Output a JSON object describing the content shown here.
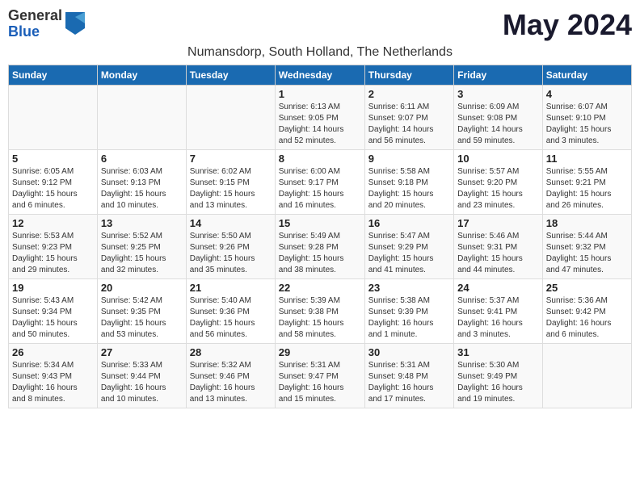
{
  "logo": {
    "general": "General",
    "blue": "Blue"
  },
  "title": "May 2024",
  "subtitle": "Numansdorp, South Holland, The Netherlands",
  "headers": [
    "Sunday",
    "Monday",
    "Tuesday",
    "Wednesday",
    "Thursday",
    "Friday",
    "Saturday"
  ],
  "weeks": [
    [
      {
        "day": "",
        "info": ""
      },
      {
        "day": "",
        "info": ""
      },
      {
        "day": "",
        "info": ""
      },
      {
        "day": "1",
        "info": "Sunrise: 6:13 AM\nSunset: 9:05 PM\nDaylight: 14 hours\nand 52 minutes."
      },
      {
        "day": "2",
        "info": "Sunrise: 6:11 AM\nSunset: 9:07 PM\nDaylight: 14 hours\nand 56 minutes."
      },
      {
        "day": "3",
        "info": "Sunrise: 6:09 AM\nSunset: 9:08 PM\nDaylight: 14 hours\nand 59 minutes."
      },
      {
        "day": "4",
        "info": "Sunrise: 6:07 AM\nSunset: 9:10 PM\nDaylight: 15 hours\nand 3 minutes."
      }
    ],
    [
      {
        "day": "5",
        "info": "Sunrise: 6:05 AM\nSunset: 9:12 PM\nDaylight: 15 hours\nand 6 minutes."
      },
      {
        "day": "6",
        "info": "Sunrise: 6:03 AM\nSunset: 9:13 PM\nDaylight: 15 hours\nand 10 minutes."
      },
      {
        "day": "7",
        "info": "Sunrise: 6:02 AM\nSunset: 9:15 PM\nDaylight: 15 hours\nand 13 minutes."
      },
      {
        "day": "8",
        "info": "Sunrise: 6:00 AM\nSunset: 9:17 PM\nDaylight: 15 hours\nand 16 minutes."
      },
      {
        "day": "9",
        "info": "Sunrise: 5:58 AM\nSunset: 9:18 PM\nDaylight: 15 hours\nand 20 minutes."
      },
      {
        "day": "10",
        "info": "Sunrise: 5:57 AM\nSunset: 9:20 PM\nDaylight: 15 hours\nand 23 minutes."
      },
      {
        "day": "11",
        "info": "Sunrise: 5:55 AM\nSunset: 9:21 PM\nDaylight: 15 hours\nand 26 minutes."
      }
    ],
    [
      {
        "day": "12",
        "info": "Sunrise: 5:53 AM\nSunset: 9:23 PM\nDaylight: 15 hours\nand 29 minutes."
      },
      {
        "day": "13",
        "info": "Sunrise: 5:52 AM\nSunset: 9:25 PM\nDaylight: 15 hours\nand 32 minutes."
      },
      {
        "day": "14",
        "info": "Sunrise: 5:50 AM\nSunset: 9:26 PM\nDaylight: 15 hours\nand 35 minutes."
      },
      {
        "day": "15",
        "info": "Sunrise: 5:49 AM\nSunset: 9:28 PM\nDaylight: 15 hours\nand 38 minutes."
      },
      {
        "day": "16",
        "info": "Sunrise: 5:47 AM\nSunset: 9:29 PM\nDaylight: 15 hours\nand 41 minutes."
      },
      {
        "day": "17",
        "info": "Sunrise: 5:46 AM\nSunset: 9:31 PM\nDaylight: 15 hours\nand 44 minutes."
      },
      {
        "day": "18",
        "info": "Sunrise: 5:44 AM\nSunset: 9:32 PM\nDaylight: 15 hours\nand 47 minutes."
      }
    ],
    [
      {
        "day": "19",
        "info": "Sunrise: 5:43 AM\nSunset: 9:34 PM\nDaylight: 15 hours\nand 50 minutes."
      },
      {
        "day": "20",
        "info": "Sunrise: 5:42 AM\nSunset: 9:35 PM\nDaylight: 15 hours\nand 53 minutes."
      },
      {
        "day": "21",
        "info": "Sunrise: 5:40 AM\nSunset: 9:36 PM\nDaylight: 15 hours\nand 56 minutes."
      },
      {
        "day": "22",
        "info": "Sunrise: 5:39 AM\nSunset: 9:38 PM\nDaylight: 15 hours\nand 58 minutes."
      },
      {
        "day": "23",
        "info": "Sunrise: 5:38 AM\nSunset: 9:39 PM\nDaylight: 16 hours\nand 1 minute."
      },
      {
        "day": "24",
        "info": "Sunrise: 5:37 AM\nSunset: 9:41 PM\nDaylight: 16 hours\nand 3 minutes."
      },
      {
        "day": "25",
        "info": "Sunrise: 5:36 AM\nSunset: 9:42 PM\nDaylight: 16 hours\nand 6 minutes."
      }
    ],
    [
      {
        "day": "26",
        "info": "Sunrise: 5:34 AM\nSunset: 9:43 PM\nDaylight: 16 hours\nand 8 minutes."
      },
      {
        "day": "27",
        "info": "Sunrise: 5:33 AM\nSunset: 9:44 PM\nDaylight: 16 hours\nand 10 minutes."
      },
      {
        "day": "28",
        "info": "Sunrise: 5:32 AM\nSunset: 9:46 PM\nDaylight: 16 hours\nand 13 minutes."
      },
      {
        "day": "29",
        "info": "Sunrise: 5:31 AM\nSunset: 9:47 PM\nDaylight: 16 hours\nand 15 minutes."
      },
      {
        "day": "30",
        "info": "Sunrise: 5:31 AM\nSunset: 9:48 PM\nDaylight: 16 hours\nand 17 minutes."
      },
      {
        "day": "31",
        "info": "Sunrise: 5:30 AM\nSunset: 9:49 PM\nDaylight: 16 hours\nand 19 minutes."
      },
      {
        "day": "",
        "info": ""
      }
    ]
  ]
}
